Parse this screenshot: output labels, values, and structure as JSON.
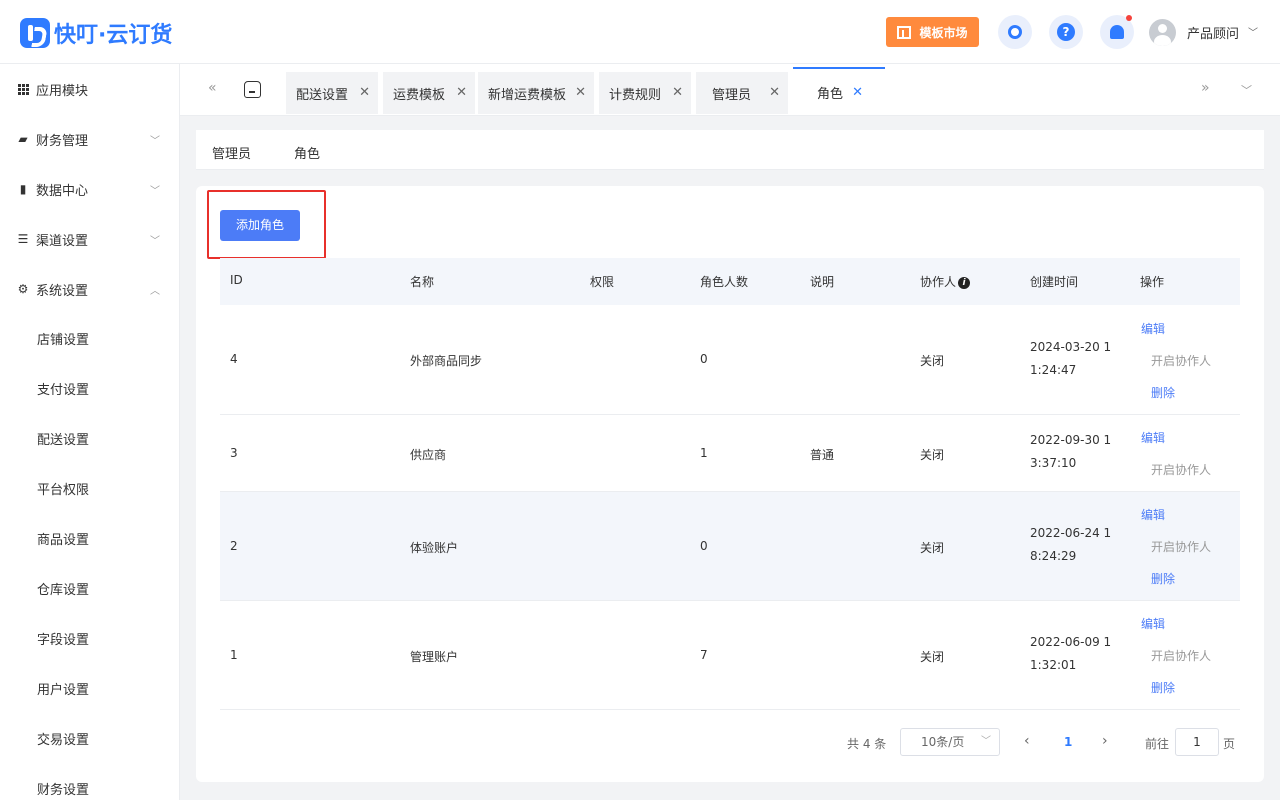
{
  "header": {
    "brand": "快叮·云订货",
    "market_label": "模板市场",
    "help_glyph": "?",
    "user_name": "产品顾问",
    "icons": [
      "customer-service-icon",
      "help-icon",
      "bell-icon"
    ]
  },
  "sidebar": {
    "items": [
      {
        "label": "应用模块",
        "icon": "grid-icon"
      },
      {
        "label": "财务管理",
        "icon": "wallet-icon"
      },
      {
        "label": "数据中心",
        "icon": "bar-chart-icon"
      },
      {
        "label": "渠道设置",
        "icon": "list-icon"
      },
      {
        "label": "系统设置",
        "icon": "gear-icon"
      }
    ],
    "sub_items": [
      "店铺设置",
      "支付设置",
      "配送设置",
      "平台权限",
      "商品设置",
      "仓库设置",
      "字段设置",
      "用户设置",
      "交易设置",
      "财务设置"
    ]
  },
  "tabs": [
    {
      "label": "配送设置"
    },
    {
      "label": "运费模板"
    },
    {
      "label": "新增运费模板"
    },
    {
      "label": "计费规则"
    },
    {
      "label": "管理员"
    },
    {
      "label": "角色",
      "active": true
    }
  ],
  "subtabs": [
    "管理员",
    "角色"
  ],
  "add_button": "添加角色",
  "table": {
    "headers": [
      "ID",
      "名称",
      "权限",
      "角色人数",
      "说明",
      "协作人",
      "创建时间",
      "操作"
    ],
    "rows": [
      {
        "id": "4",
        "name": "外部商品同步",
        "perm": "",
        "count": "0",
        "desc": "",
        "collab": "关闭",
        "created": "2024-03-20 11:24:47",
        "actions": [
          "编辑",
          "开启协作人",
          "删除"
        ]
      },
      {
        "id": "3",
        "name": "供应商",
        "perm": "",
        "count": "1",
        "desc": "普通",
        "collab": "关闭",
        "created": "2022-09-30 13:37:10",
        "actions": [
          "编辑",
          "开启协作人"
        ]
      },
      {
        "id": "2",
        "name": "体验账户",
        "perm": "",
        "count": "0",
        "desc": "",
        "collab": "关闭",
        "created": "2022-06-24 18:24:29",
        "actions": [
          "编辑",
          "开启协作人",
          "删除"
        ]
      },
      {
        "id": "1",
        "name": "管理账户",
        "perm": "",
        "count": "7",
        "desc": "",
        "collab": "关闭",
        "created": "2022-06-09 11:32:01",
        "actions": [
          "编辑",
          "开启协作人",
          "删除"
        ]
      }
    ]
  },
  "pagination": {
    "total": "共 4 条",
    "page_size": "10条/页",
    "current": "1",
    "goto_label": "前往",
    "goto_value": "1",
    "page_label": "页"
  },
  "colors": {
    "accent": "#2f7bff",
    "button": "#4c7cf7",
    "market": "#ff8a3d",
    "highlight": "#e8302b"
  }
}
